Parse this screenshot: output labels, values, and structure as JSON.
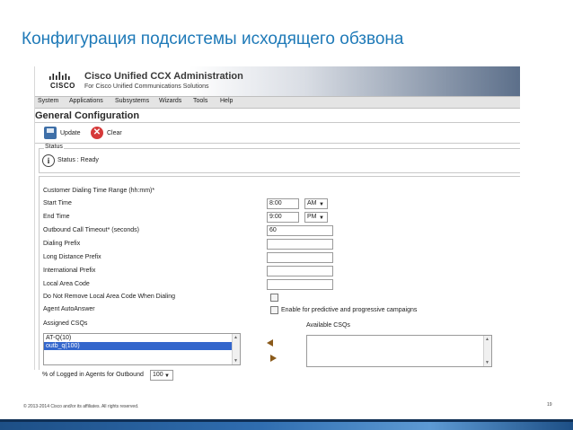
{
  "slide": {
    "title": "Конфигурация подсистемы исходящего обзвона",
    "footer": "© 2013-2014  Cisco and/or its affiliates. All rights reserved.",
    "page_number": "19"
  },
  "app": {
    "logo_word": "CISCO",
    "title": "Cisco Unified CCX Administration",
    "subtitle": "For Cisco Unified Communications Solutions"
  },
  "menu": [
    "System",
    "Applications",
    "Subsystems",
    "Wizards",
    "Tools",
    "Help"
  ],
  "page": {
    "heading": "General Configuration",
    "toolbar": {
      "update_label": "Update",
      "clear_label": "Clear"
    },
    "status": {
      "legend": "Status",
      "text": "Status : Ready"
    }
  },
  "form": {
    "dialing_range_label": "Customer Dialing Time Range (hh:mm)*",
    "start_time": {
      "label": "Start Time",
      "value": "8:00",
      "ampm": "AM"
    },
    "end_time": {
      "label": "End Time",
      "value": "9:00",
      "ampm": "PM"
    },
    "timeout": {
      "label": "Outbound Call Timeout* (seconds)",
      "value": "60"
    },
    "dialing_prefix": {
      "label": "Dialing Prefix",
      "value": ""
    },
    "long_distance_prefix": {
      "label": "Long Distance Prefix",
      "value": ""
    },
    "international_prefix": {
      "label": "International Prefix",
      "value": ""
    },
    "local_area_code": {
      "label": "Local Area Code",
      "value": ""
    },
    "remove_local_area_code": {
      "label": "Do Not Remove Local Area Code When Dialing"
    },
    "agent_autoanswer": {
      "label": "Agent AutoAnswer",
      "checkbox_label": "Enable for predictive and progressive campaigns"
    },
    "assigned_csqs": {
      "label": "Assigned CSQs",
      "items": [
        "AT-Q(10)",
        "outb_q(100)"
      ],
      "selected": "outb_q(100)"
    },
    "available_csqs": {
      "label": "Available CSQs",
      "items": []
    },
    "logged_in_agents": {
      "label": "% of Logged in Agents for Outbound",
      "value": "100"
    }
  },
  "colors": {
    "slide_title": "#1f7ab8",
    "selection": "#3366cc",
    "arrow": "#8a5a1a",
    "bottom_stripe": "#2f6db0"
  }
}
